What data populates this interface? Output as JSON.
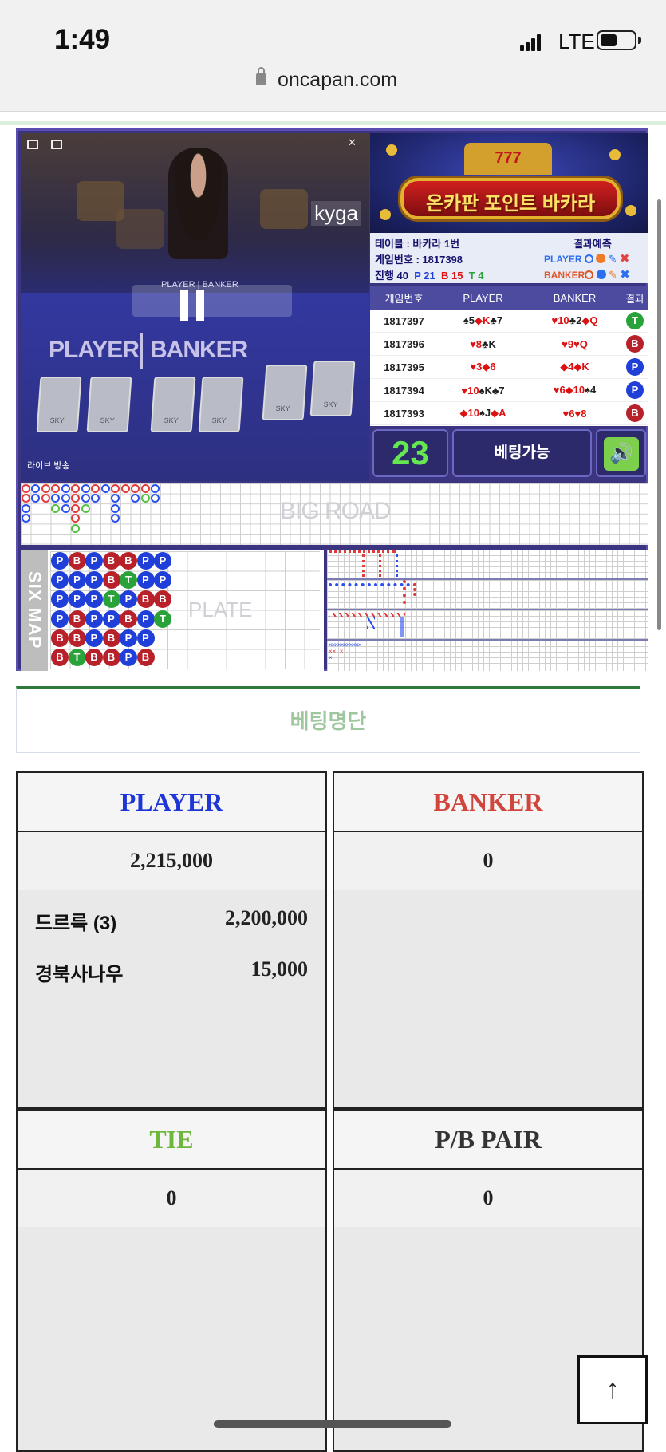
{
  "status_bar": {
    "time": "1:49",
    "network": "LTE",
    "url": "oncapan.com"
  },
  "video": {
    "overlay_label_player": "PLAYER",
    "overlay_label_banker": "BANKER",
    "watermark": "kyga",
    "live_label": "라이브 방송",
    "state": "paused"
  },
  "banner": {
    "title": "온카판 포인트 바카라",
    "slot_text": "777"
  },
  "table_info": {
    "table": "테이블 : 바카라 1번",
    "game_no": "게임번호 : 1817398",
    "progress_label": "진행",
    "progress": "40",
    "p_count": "P 21",
    "b_count": "B 15",
    "t_count": "T 4",
    "predict_title": "결과예측",
    "predict_player": "PLAYER",
    "predict_banker": "BANKER"
  },
  "results": {
    "headers": [
      "게임번호",
      "PLAYER",
      "BANKER",
      "결과"
    ],
    "rows": [
      {
        "no": "1817397",
        "player": "♠5◆K♣7",
        "banker": "♥10♣2◆Q",
        "result": "T"
      },
      {
        "no": "1817396",
        "player": "♥8♣K",
        "banker": "♥9♥Q",
        "result": "B"
      },
      {
        "no": "1817395",
        "player": "♥3◆6",
        "banker": "◆4◆K",
        "result": "P"
      },
      {
        "no": "1817394",
        "player": "♥10♠K♣7",
        "banker": "♥6◆10♠4",
        "result": "P"
      },
      {
        "no": "1817393",
        "player": "◆10♠J◆A",
        "banker": "♥6♥8",
        "result": "B"
      }
    ]
  },
  "countdown": "23",
  "bet_status": "베팅가능",
  "sound_icon": "speaker-icon",
  "big_road": {
    "label": "BIG ROAD"
  },
  "six_map": {
    "label": "SIX MAP",
    "plate_label": "PLATE",
    "columns": [
      [
        "P",
        "P",
        "P",
        "P",
        "B",
        "B"
      ],
      [
        "B",
        "P",
        "P",
        "B",
        "B",
        "T"
      ],
      [
        "P",
        "P",
        "P",
        "P",
        "P",
        "B"
      ],
      [
        "B",
        "B",
        "T",
        "P",
        "B",
        "B"
      ],
      [
        "B",
        "T",
        "P",
        "B",
        "P",
        "P"
      ],
      [
        "P",
        "P",
        "B",
        "P",
        "P",
        "B"
      ],
      [
        "P",
        "P",
        "B",
        "T"
      ]
    ]
  },
  "bet_list_title": "베팅명단",
  "panels": {
    "player": {
      "title": "PLAYER",
      "total": "2,215,000",
      "color": "#1f36d6",
      "bettors": [
        {
          "name": "드르륵 (3)",
          "amount": "2,200,000"
        },
        {
          "name": "경북사나우",
          "amount": "15,000"
        }
      ]
    },
    "banker": {
      "title": "BANKER",
      "total": "0",
      "color": "#d0463c",
      "bettors": []
    },
    "tie": {
      "title": "TIE",
      "total": "0",
      "color": "#6fb63c",
      "bettors": []
    },
    "pair": {
      "title": "P/B PAIR",
      "total": "0",
      "color": "#333333",
      "bettors": []
    }
  },
  "scroll_top_icon": "arrow-up-icon"
}
